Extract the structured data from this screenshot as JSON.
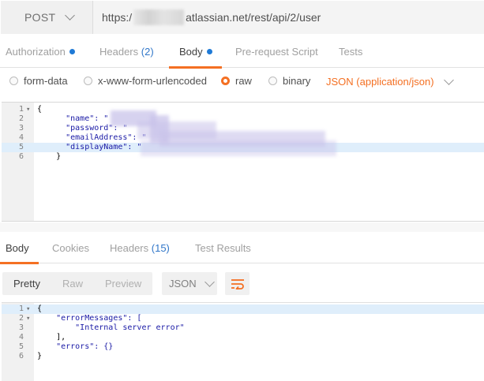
{
  "request": {
    "method": "POST",
    "url_prefix": "https:/",
    "url_suffix": "atlassian.net/rest/api/2/user"
  },
  "request_tabs": [
    {
      "label": "Authorization",
      "count": "",
      "dot": true,
      "active": false
    },
    {
      "label": "Headers",
      "count": "(2)",
      "dot": false,
      "active": false
    },
    {
      "label": "Body",
      "count": "",
      "dot": true,
      "active": true
    },
    {
      "label": "Pre-request Script",
      "count": "",
      "dot": false,
      "active": false
    },
    {
      "label": "Tests",
      "count": "",
      "dot": false,
      "active": false
    }
  ],
  "body_types": [
    {
      "label": "form-data",
      "selected": false
    },
    {
      "label": "x-www-form-urlencoded",
      "selected": false
    },
    {
      "label": "raw",
      "selected": true
    },
    {
      "label": "binary",
      "selected": false
    }
  ],
  "content_type": "JSON (application/json)",
  "request_body": {
    "lines": [
      {
        "n": "1",
        "fold": "▾",
        "text": "{"
      },
      {
        "n": "2",
        "fold": "",
        "text": "      \"name\": \""
      },
      {
        "n": "3",
        "fold": "",
        "text": "      \"password\": \""
      },
      {
        "n": "4",
        "fold": "",
        "text": "      \"emailAddress\": \""
      },
      {
        "n": "5",
        "fold": "",
        "text": "      \"displayName\": \""
      },
      {
        "n": "6",
        "fold": "",
        "text": "    }"
      }
    ]
  },
  "response_tabs": [
    {
      "label": "Body",
      "count": "",
      "active": true
    },
    {
      "label": "Cookies",
      "count": "",
      "active": false
    },
    {
      "label": "Headers",
      "count": "(15)",
      "active": false
    },
    {
      "label": "Test Results",
      "count": "",
      "active": false
    }
  ],
  "view_modes": [
    {
      "label": "Pretty",
      "selected": true
    },
    {
      "label": "Raw",
      "selected": false
    },
    {
      "label": "Preview",
      "selected": false
    }
  ],
  "response_format": "JSON",
  "response_body": {
    "lines": [
      {
        "n": "1",
        "fold": "▾",
        "text": "{"
      },
      {
        "n": "2",
        "fold": "▾",
        "text": "    \"errorMessages\": ["
      },
      {
        "n": "3",
        "fold": "",
        "text": "        \"Internal server error\""
      },
      {
        "n": "4",
        "fold": "",
        "text": "    ],"
      },
      {
        "n": "5",
        "fold": "",
        "text": "    \"errors\": {}"
      },
      {
        "n": "6",
        "fold": "",
        "text": "}"
      }
    ]
  },
  "colors": {
    "accent": "#f47023",
    "link": "#3177c9",
    "highlight_line": "#dfeefb"
  }
}
